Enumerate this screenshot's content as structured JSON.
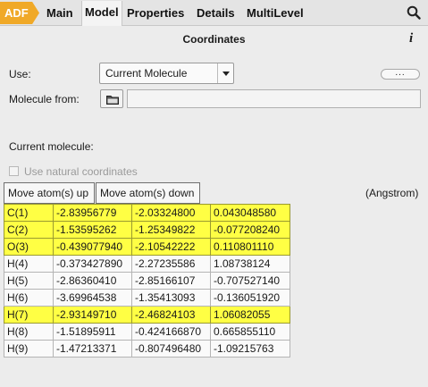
{
  "tabs": {
    "adf": "ADF",
    "items": [
      "Main",
      "Model",
      "Properties",
      "Details",
      "MultiLevel"
    ]
  },
  "panel": {
    "title": "Coordinates",
    "info": "i"
  },
  "use": {
    "label": "Use:",
    "selected": "Current Molecule",
    "dots": "..."
  },
  "molecule_from": {
    "label": "Molecule from:",
    "value": ""
  },
  "current_molecule": {
    "label": "Current molecule:",
    "natural_coords_label": "Use natural coordinates",
    "natural_coords_checked": false
  },
  "buttons": {
    "move_up": "Move atom(s) up",
    "move_down": "Move atom(s) down"
  },
  "units": "(Angstrom)",
  "atoms": [
    {
      "label": "C(1)",
      "x": "-2.83956779",
      "y": "-2.03324800",
      "z": "0.043048580",
      "selected": true
    },
    {
      "label": "C(2)",
      "x": "-1.53595262",
      "y": "-1.25349822",
      "z": "-0.077208240",
      "selected": true
    },
    {
      "label": "O(3)",
      "x": "-0.439077940",
      "y": "-2.10542222",
      "z": "0.110801110",
      "selected": true
    },
    {
      "label": "H(4)",
      "x": "-0.373427890",
      "y": "-2.27235586",
      "z": "1.08738124",
      "selected": false
    },
    {
      "label": "H(5)",
      "x": "-2.86360410",
      "y": "-2.85166107",
      "z": "-0.707527140",
      "selected": false
    },
    {
      "label": "H(6)",
      "x": "-3.69964538",
      "y": "-1.35413093",
      "z": "-0.136051920",
      "selected": false
    },
    {
      "label": "H(7)",
      "x": "-2.93149710",
      "y": "-2.46824103",
      "z": "1.06082055",
      "selected": true
    },
    {
      "label": "H(8)",
      "x": "-1.51895911",
      "y": "-0.424166870",
      "z": "0.665855110",
      "selected": false
    },
    {
      "label": "H(9)",
      "x": "-1.47213371",
      "y": "-0.807496480",
      "z": "-1.09215763",
      "selected": false
    }
  ],
  "colors": {
    "adf_tab": "#f0a928",
    "selected_row": "#ffff44"
  }
}
